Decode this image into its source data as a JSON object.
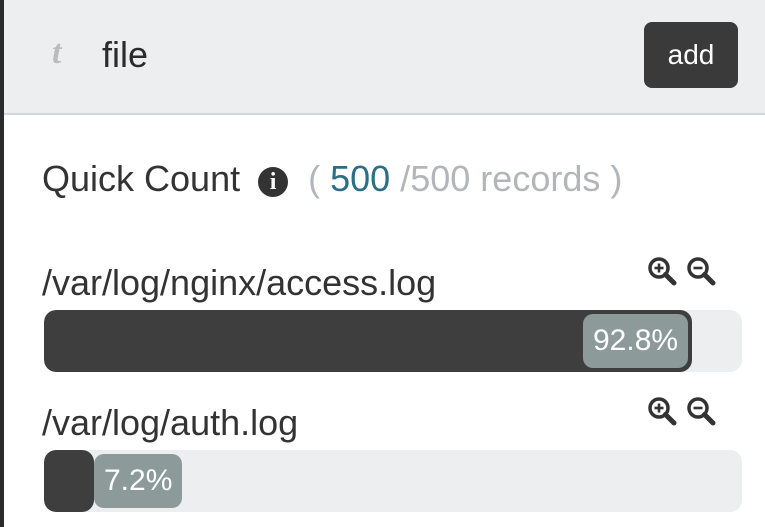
{
  "field": {
    "type_icon": "t",
    "name": "file",
    "add_label": "add"
  },
  "quick_count": {
    "label": "Quick Count",
    "info_icon": "i",
    "open_paren": "(",
    "count": "500",
    "total": "/500 records",
    "close_paren": ")"
  },
  "entries": [
    {
      "path": "/var/log/nginx/access.log",
      "percent_label": "92.8%",
      "percent": 92.8,
      "icons": [
        "zoom-in-icon",
        "zoom-out-icon"
      ]
    },
    {
      "path": "/var/log/auth.log",
      "percent_label": "7.2%",
      "percent": 7.2,
      "icons": [
        "zoom-in-icon",
        "zoom-out-icon"
      ]
    }
  ],
  "colors": {
    "header_bg": "#eceeef",
    "bar_fill": "#3e3e3e",
    "bar_label_bg": "#8d9a9a",
    "count_accent": "#2a6f86",
    "muted_text": "#b2b6b9"
  }
}
